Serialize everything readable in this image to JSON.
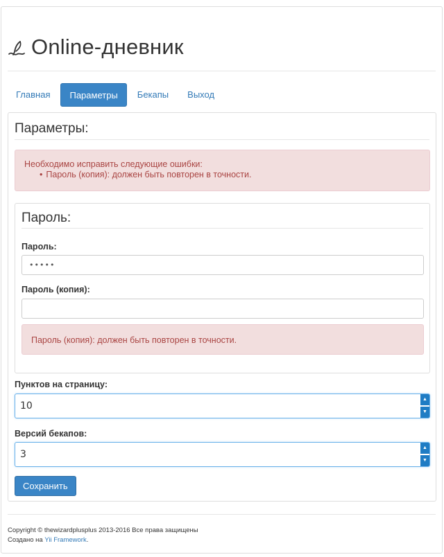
{
  "header": {
    "logo_icon": "quill-pen-icon",
    "title": "Online-дневник"
  },
  "nav": {
    "items": [
      {
        "label": "Главная",
        "active": false
      },
      {
        "label": "Параметры",
        "active": true
      },
      {
        "label": "Бекапы",
        "active": false
      },
      {
        "label": "Выход",
        "active": false
      }
    ]
  },
  "form": {
    "legend": "Параметры:",
    "error_summary": {
      "heading": "Необходимо исправить следующие ошибки:",
      "items": [
        "Пароль (копия): должен быть повторен в точности."
      ]
    },
    "password_fieldset": {
      "legend": "Пароль:",
      "password_label": "Пароль:",
      "password_value": "•••••",
      "password_copy_label": "Пароль (копия):",
      "password_copy_value": "",
      "password_copy_error": "Пароль (копия): должен быть повторен в точности."
    },
    "points_per_page_label": "Пунктов на страницу:",
    "points_per_page_value": "10",
    "backup_versions_label": "Версий бекапов:",
    "backup_versions_value": "3",
    "save_label": "Сохранить"
  },
  "footer": {
    "copyright": "Copyright © thewizardplusplus 2013-2016 Все права защищены",
    "created_prefix": "Создано на ",
    "framework_link": "Yii Framework",
    "created_suffix": "."
  },
  "colors": {
    "primary": "#3a85c6",
    "link": "#337ab7",
    "error_bg": "#f2dede",
    "error_text": "#a94442"
  }
}
